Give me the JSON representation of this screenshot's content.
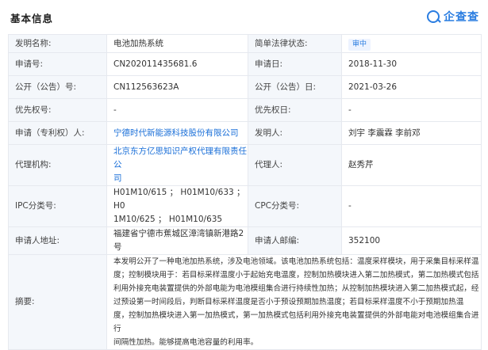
{
  "section_title": "基本信息",
  "logo": {
    "icon": "qichacha-logo-icon",
    "text": "企查查",
    "color": "#2a7de1"
  },
  "fields": {
    "invention_name": {
      "label": "发明名称:",
      "value": "电池加热系统"
    },
    "legal_status": {
      "label": "简单法律状态:",
      "value": "审中"
    },
    "application_no": {
      "label": "申请号:",
      "value": "CN202011435681.6"
    },
    "application_date": {
      "label": "申请日:",
      "value": "2018-11-30"
    },
    "publication_no": {
      "label": "公开（公告）号:",
      "value": "CN112563623A"
    },
    "publication_date": {
      "label": "公开（公告）日:",
      "value": "2021-03-26"
    },
    "priority_no": {
      "label": "优先权号:",
      "value": "-"
    },
    "priority_date": {
      "label": "优先权日:",
      "value": "-"
    },
    "applicant": {
      "label": "申请（专利权）人:",
      "value": "宁德时代新能源科技股份有限公司"
    },
    "inventor": {
      "label": "发明人:",
      "value": "刘宇 李震霖 李前邓"
    },
    "agency": {
      "label": "代理机构:",
      "value_line1": "北京东方亿思知识产权代理有限责任公",
      "value_line2": "司"
    },
    "agent": {
      "label": "代理人:",
      "value": "赵秀芹"
    },
    "ipc": {
      "label": "IPC分类号:",
      "value_line1": "H01M10/615 ；  H01M10/633 ；  H0",
      "value_line2": "1M10/625 ；  H01M10/635"
    },
    "cpc": {
      "label": "CPC分类号:",
      "value": "-"
    },
    "address": {
      "label": "申请人地址:",
      "value": "福建省宁德市蕉城区漳湾镇新港路2号"
    },
    "postcode": {
      "label": "申请人邮编:",
      "value": "352100"
    },
    "abstract": {
      "label": "摘要:",
      "lines": [
        "本发明公开了一种电池加热系统，涉及电池领域。该电池加热系统包括：温度采样模块，用于采集目标采样温",
        "度；控制模块用于：若目标采样温度小于起始充电温度，控制加热模块进入第二加热模式，第二加热模式包括",
        "利用外接充电装置提供的外部电能为电池模组集合进行持续性加热；从控制加热模块进入第二加热模式起，经",
        "过预设第一时间段后，判断目标采样温度是否小于预设预期加热温度；若目标采样温度不小于预期加热温",
        "度，控制加热模块进入第一加热模式，第一加热模式包括利用外接充电装置提供的外部电能对电池模组集合进行",
        "间隔性加热。能够提高电池容量的利用率。"
      ]
    }
  }
}
